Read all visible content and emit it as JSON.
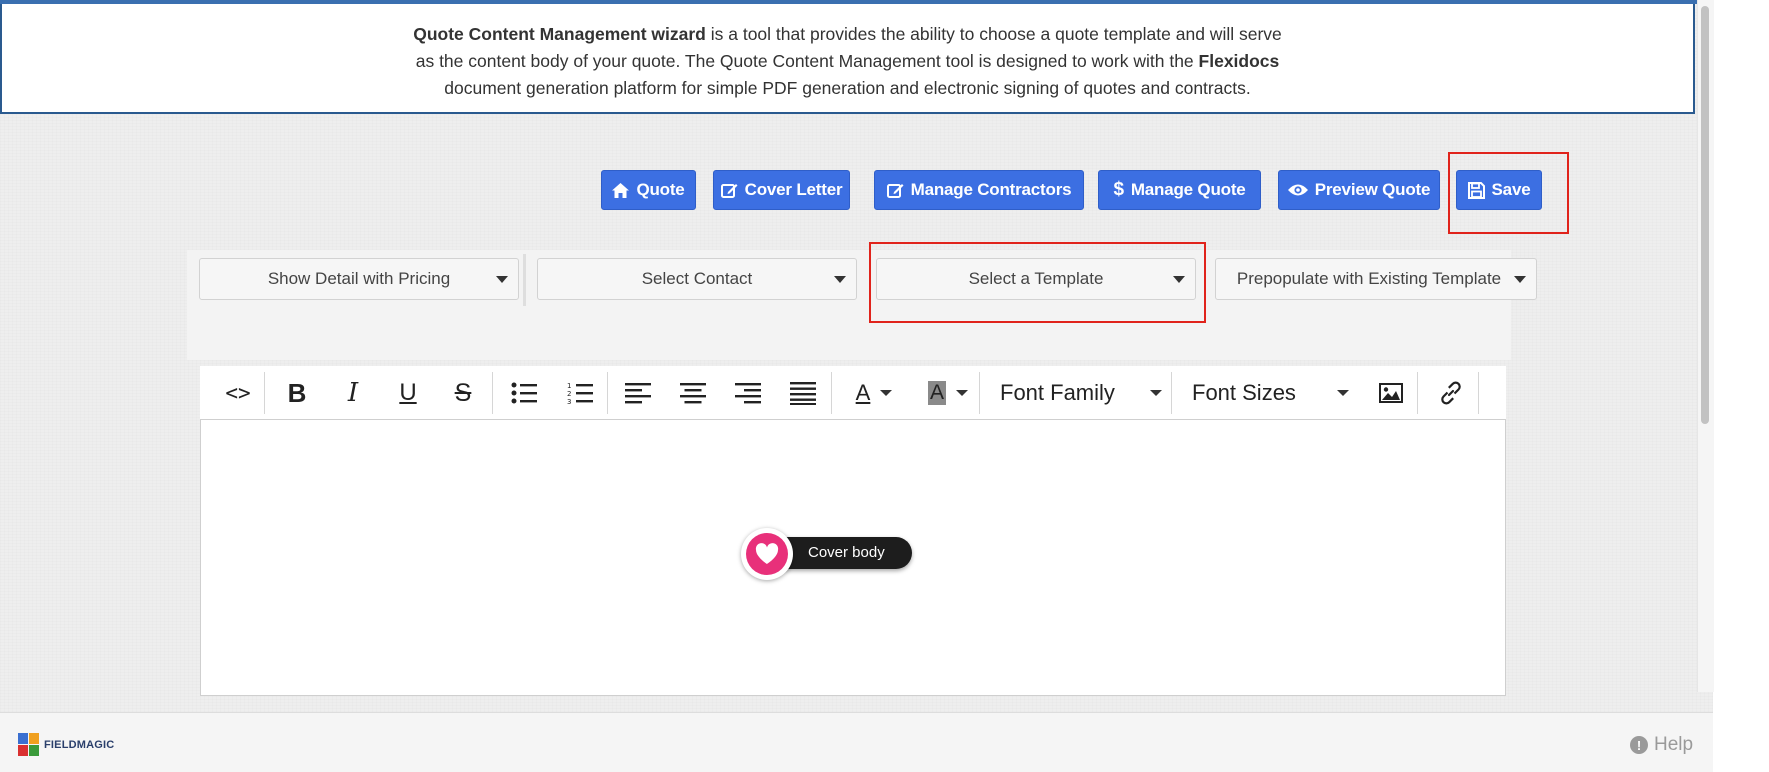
{
  "banner": {
    "line1_bold": "Quote Content Management wizard",
    "line1_rest": " is a tool that provides the ability to choose a quote template and will serve",
    "line2_start": "as the content body of your quote. The Quote Content Management tool is designed to work with the ",
    "line2_bold": "Flexidocs",
    "line3": "document generation platform for simple PDF generation and electronic signing of quotes and contracts."
  },
  "actions": {
    "quote": {
      "label": "Quote",
      "icon": "home-icon"
    },
    "cover_letter": {
      "label": "Cover Letter",
      "icon": "edit-icon"
    },
    "manage_contractors": {
      "label": "Manage Contractors",
      "icon": "edit-icon"
    },
    "manage_quote": {
      "label": "Manage Quote",
      "icon": "dollar-icon"
    },
    "preview_quote": {
      "label": "Preview Quote",
      "icon": "eye-icon"
    },
    "save": {
      "label": "Save",
      "icon": "floppy-disk-icon"
    }
  },
  "selects": {
    "detail": "Show Detail with Pricing",
    "contact": "Select Contact",
    "template": "Select a Template",
    "prepopulate": "Prepopulate with Existing Template"
  },
  "toolbar": {
    "code_glyph": "<>",
    "bold_glyph": "B",
    "italic_glyph": "I",
    "underline_glyph": "U",
    "strike_glyph": "S",
    "font_color_glyph": "A",
    "highlight_glyph": "A",
    "font_family": "Font Family",
    "font_sizes": "Font Sizes"
  },
  "tooltip": {
    "label": "Cover body"
  },
  "footer": {
    "brand": "FIELDMAGIC",
    "help": "Help",
    "help_glyph": "!"
  },
  "colors": {
    "button_blue": "#3c6fe2",
    "highlight_red": "#e0231b",
    "heart_pink": "#e8307a",
    "banner_border": "#2a5a8f"
  }
}
